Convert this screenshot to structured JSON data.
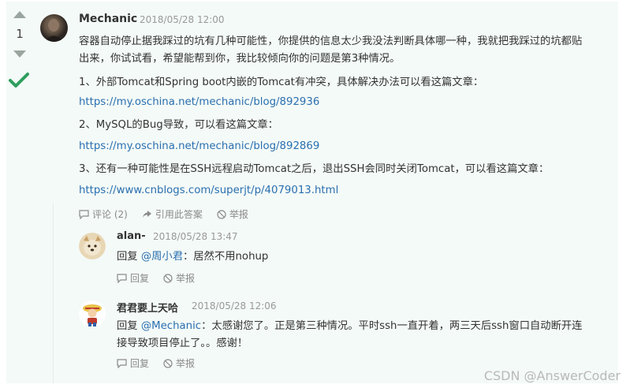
{
  "vote": {
    "count": "1"
  },
  "answer": {
    "author": "Mechanic",
    "date": "2018/05/28 12:00",
    "lines": [
      "容器自动停止据我踩过的坑有几种可能性，你提供的信息太少我没法判断具体哪一种，我就把我踩过的坑都贴",
      "出来，你试试看，希望能帮到你，我比较倾向你的问题是第3种情况。",
      "1、外部Tomcat和Spring boot内嵌的Tomcat有冲突，具体解决办法可以看这篇文章：",
      "2、MySQL的Bug导致，可以看这篇文章：",
      "3、还有一种可能性是在SSH远程启动Tomcat之后，退出SSH会同时关闭Tomcat，可以看这篇文章："
    ],
    "links": [
      "https://my.oschina.net/mechanic/blog/892936",
      "https://my.oschina.net/mechanic/blog/892869",
      "https://www.cnblogs.com/superjt/p/4079013.html"
    ],
    "actions": {
      "comment": "评论 (2)",
      "quote": "引用此答案",
      "report": "举报"
    }
  },
  "comments": [
    {
      "author": "alan-",
      "date": "2018/05/28 13:47",
      "reply_prefix": "回复",
      "mention": "@周小君",
      "text": "：居然不用nohup",
      "text2": "",
      "reply": "回复",
      "report": "举报"
    },
    {
      "author": "君君要上天哈",
      "date": "2018/05/28 12:06",
      "reply_prefix": "回复",
      "mention": "@Mechanic",
      "text": "：太感谢您了。正是第三种情况。平时ssh一直开着，两三天后ssh窗口自动断开连",
      "text2": "接导致项目停止了。。感谢！",
      "reply": "回复",
      "report": "举报"
    }
  ],
  "watermark": "CSDN @AnswerCoder",
  "colors": {
    "link": "#2a6fb0",
    "accepted": "#2e9e5e",
    "background": "#f4faf7"
  }
}
